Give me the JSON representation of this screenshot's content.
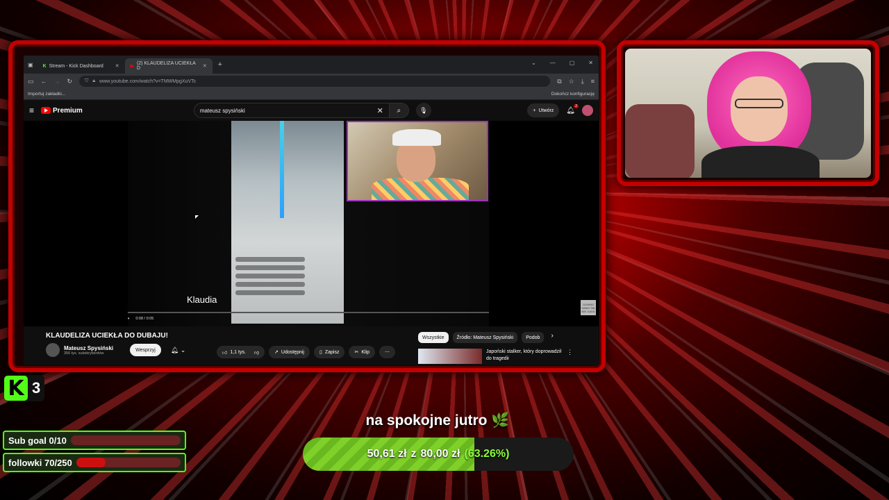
{
  "browser": {
    "tabs": [
      {
        "label": "Stream - Kick Dashboard"
      },
      {
        "label": "(2) KLAUDELIZA UCIEKŁA D"
      }
    ],
    "url": "www.youtube.com/watch?v=TMWMpgXuVTc",
    "bookmark_left": "Importuj zakładki...",
    "bookmark_right": "Dokończ konfigurację"
  },
  "youtube": {
    "logo": "Premium",
    "search_value": "mateusz spysiński",
    "create_label": "Utwórz",
    "notif_count": "2",
    "caption": "Klaudia",
    "time": "0:08 / 0:05",
    "logo_badge": "GOWNO SAMO SIĘ NIE GADA",
    "video_title": "KLAUDELIZA UCIEKŁA DO DUBAJU!",
    "channel_name": "Mateusz Spysiński",
    "channel_subs": "356 tys. subskrybentów",
    "support_label": "Wesprzyj",
    "likes": "1,1 tys.",
    "share_label": "Udostępnij",
    "save_label": "Zapisz",
    "clip_label": "Klip",
    "chips": [
      "Wszystkie",
      "Źródło: Mateusz Spysiński",
      "Podob"
    ],
    "rec_title": "Japoński stalker, który doprowadził do tragedii"
  },
  "overlay": {
    "kick_count": "3",
    "sub_goal": "Sub goal 0/10",
    "sub_progress": 0.0,
    "follow_goal": "followki 70/250",
    "follow_progress": 0.28,
    "donation_title": "na spokojne jutro 🌿",
    "donation_current": "50,61 zł",
    "donation_sep": "z",
    "donation_target": "80,00 zł",
    "donation_percent": "(63.26%)",
    "donation_progress": 0.6326
  },
  "colors": {
    "frame": "#c40000",
    "kick_green": "#53fc18",
    "donation_green": "#7fd12a"
  }
}
